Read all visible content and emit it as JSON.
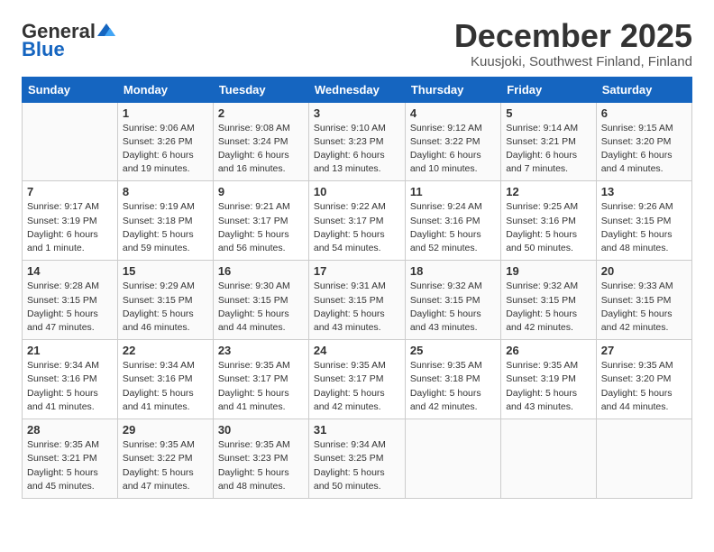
{
  "logo": {
    "general": "General",
    "blue": "Blue"
  },
  "title": {
    "month": "December 2025",
    "location": "Kuusjoki, Southwest Finland, Finland"
  },
  "weekdays": [
    "Sunday",
    "Monday",
    "Tuesday",
    "Wednesday",
    "Thursday",
    "Friday",
    "Saturday"
  ],
  "weeks": [
    [
      {
        "num": "",
        "info": ""
      },
      {
        "num": "1",
        "info": "Sunrise: 9:06 AM\nSunset: 3:26 PM\nDaylight: 6 hours\nand 19 minutes."
      },
      {
        "num": "2",
        "info": "Sunrise: 9:08 AM\nSunset: 3:24 PM\nDaylight: 6 hours\nand 16 minutes."
      },
      {
        "num": "3",
        "info": "Sunrise: 9:10 AM\nSunset: 3:23 PM\nDaylight: 6 hours\nand 13 minutes."
      },
      {
        "num": "4",
        "info": "Sunrise: 9:12 AM\nSunset: 3:22 PM\nDaylight: 6 hours\nand 10 minutes."
      },
      {
        "num": "5",
        "info": "Sunrise: 9:14 AM\nSunset: 3:21 PM\nDaylight: 6 hours\nand 7 minutes."
      },
      {
        "num": "6",
        "info": "Sunrise: 9:15 AM\nSunset: 3:20 PM\nDaylight: 6 hours\nand 4 minutes."
      }
    ],
    [
      {
        "num": "7",
        "info": "Sunrise: 9:17 AM\nSunset: 3:19 PM\nDaylight: 6 hours\nand 1 minute."
      },
      {
        "num": "8",
        "info": "Sunrise: 9:19 AM\nSunset: 3:18 PM\nDaylight: 5 hours\nand 59 minutes."
      },
      {
        "num": "9",
        "info": "Sunrise: 9:21 AM\nSunset: 3:17 PM\nDaylight: 5 hours\nand 56 minutes."
      },
      {
        "num": "10",
        "info": "Sunrise: 9:22 AM\nSunset: 3:17 PM\nDaylight: 5 hours\nand 54 minutes."
      },
      {
        "num": "11",
        "info": "Sunrise: 9:24 AM\nSunset: 3:16 PM\nDaylight: 5 hours\nand 52 minutes."
      },
      {
        "num": "12",
        "info": "Sunrise: 9:25 AM\nSunset: 3:16 PM\nDaylight: 5 hours\nand 50 minutes."
      },
      {
        "num": "13",
        "info": "Sunrise: 9:26 AM\nSunset: 3:15 PM\nDaylight: 5 hours\nand 48 minutes."
      }
    ],
    [
      {
        "num": "14",
        "info": "Sunrise: 9:28 AM\nSunset: 3:15 PM\nDaylight: 5 hours\nand 47 minutes."
      },
      {
        "num": "15",
        "info": "Sunrise: 9:29 AM\nSunset: 3:15 PM\nDaylight: 5 hours\nand 46 minutes."
      },
      {
        "num": "16",
        "info": "Sunrise: 9:30 AM\nSunset: 3:15 PM\nDaylight: 5 hours\nand 44 minutes."
      },
      {
        "num": "17",
        "info": "Sunrise: 9:31 AM\nSunset: 3:15 PM\nDaylight: 5 hours\nand 43 minutes."
      },
      {
        "num": "18",
        "info": "Sunrise: 9:32 AM\nSunset: 3:15 PM\nDaylight: 5 hours\nand 43 minutes."
      },
      {
        "num": "19",
        "info": "Sunrise: 9:32 AM\nSunset: 3:15 PM\nDaylight: 5 hours\nand 42 minutes."
      },
      {
        "num": "20",
        "info": "Sunrise: 9:33 AM\nSunset: 3:15 PM\nDaylight: 5 hours\nand 42 minutes."
      }
    ],
    [
      {
        "num": "21",
        "info": "Sunrise: 9:34 AM\nSunset: 3:16 PM\nDaylight: 5 hours\nand 41 minutes."
      },
      {
        "num": "22",
        "info": "Sunrise: 9:34 AM\nSunset: 3:16 PM\nDaylight: 5 hours\nand 41 minutes."
      },
      {
        "num": "23",
        "info": "Sunrise: 9:35 AM\nSunset: 3:17 PM\nDaylight: 5 hours\nand 41 minutes."
      },
      {
        "num": "24",
        "info": "Sunrise: 9:35 AM\nSunset: 3:17 PM\nDaylight: 5 hours\nand 42 minutes."
      },
      {
        "num": "25",
        "info": "Sunrise: 9:35 AM\nSunset: 3:18 PM\nDaylight: 5 hours\nand 42 minutes."
      },
      {
        "num": "26",
        "info": "Sunrise: 9:35 AM\nSunset: 3:19 PM\nDaylight: 5 hours\nand 43 minutes."
      },
      {
        "num": "27",
        "info": "Sunrise: 9:35 AM\nSunset: 3:20 PM\nDaylight: 5 hours\nand 44 minutes."
      }
    ],
    [
      {
        "num": "28",
        "info": "Sunrise: 9:35 AM\nSunset: 3:21 PM\nDaylight: 5 hours\nand 45 minutes."
      },
      {
        "num": "29",
        "info": "Sunrise: 9:35 AM\nSunset: 3:22 PM\nDaylight: 5 hours\nand 47 minutes."
      },
      {
        "num": "30",
        "info": "Sunrise: 9:35 AM\nSunset: 3:23 PM\nDaylight: 5 hours\nand 48 minutes."
      },
      {
        "num": "31",
        "info": "Sunrise: 9:34 AM\nSunset: 3:25 PM\nDaylight: 5 hours\nand 50 minutes."
      },
      {
        "num": "",
        "info": ""
      },
      {
        "num": "",
        "info": ""
      },
      {
        "num": "",
        "info": ""
      }
    ]
  ]
}
